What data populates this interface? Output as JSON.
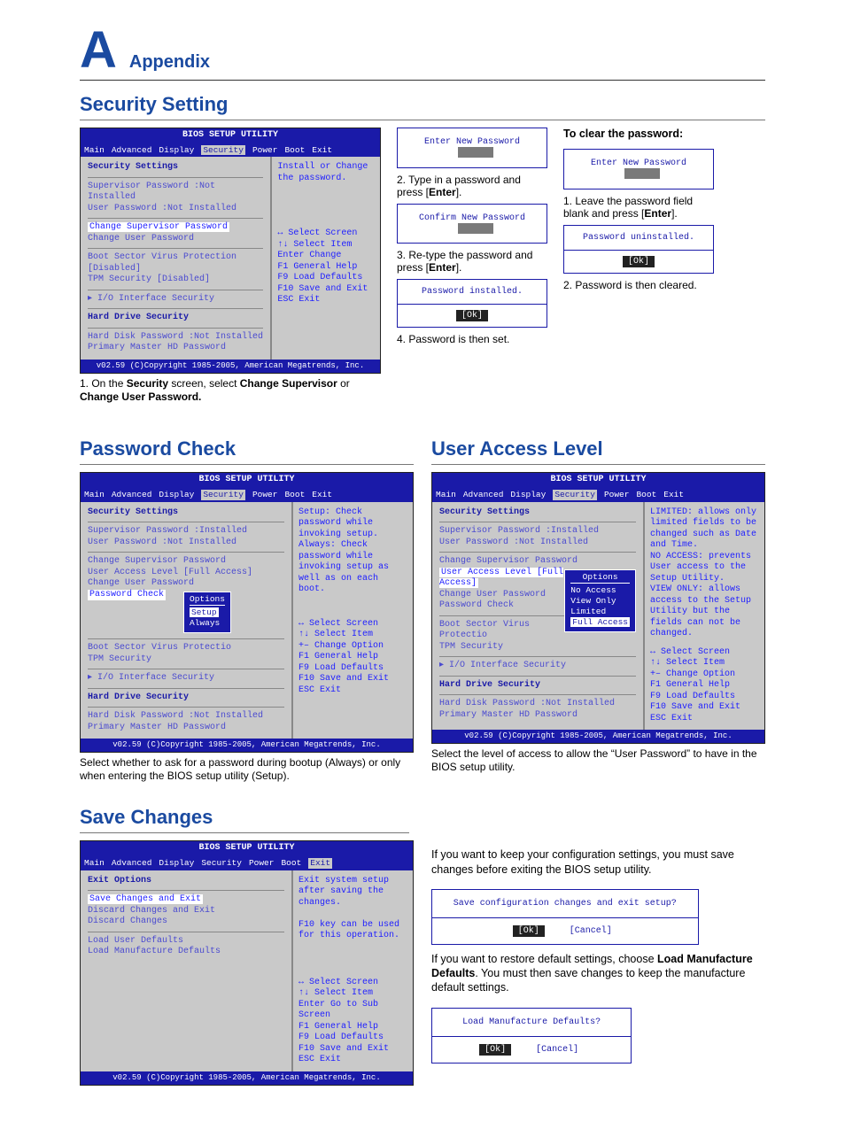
{
  "appendix": {
    "letter": "A",
    "label": "Appendix"
  },
  "sections": {
    "security": "Security Setting",
    "pwcheck": "Password Check",
    "ual": "User Access Level",
    "save": "Save Changes"
  },
  "bios_common": {
    "title": "BIOS SETUP UTILITY",
    "menus": [
      "Main",
      "Advanced",
      "Display",
      "Security",
      "Power",
      "Boot",
      "Exit"
    ],
    "footer": "v02.59 (C)Copyright 1985-2005, American Megatrends, Inc."
  },
  "bios1": {
    "active_menu": "Security",
    "pane_l_title": "Security Settings",
    "rows": [
      "Supervisor Password :Not Installed",
      "User Password       :Not Installed"
    ],
    "sel": "Change Supervisor Password",
    "rows2": [
      "Change User Password"
    ],
    "rows3": [
      "Boot Sector Virus Protection   [Disabled]",
      "TPM Security                   [Disabled]"
    ],
    "rows4": [
      "▸ I/O Interface Security"
    ],
    "hds_title": "Hard Drive Security",
    "rows5": [
      "Hard Disk Password  :Not Installed",
      "Primary Master HD Password"
    ],
    "help_top": "Install or Change the password.",
    "keys": [
      "↔     Select Screen",
      "↑↓    Select Item",
      "Enter Change",
      "F1    General Help",
      "F9    Load Defaults",
      "F10   Save and Exit",
      "ESC   Exit"
    ]
  },
  "bios1_caption": {
    "pre": "1. On the ",
    "b1": "Security",
    "mid": " screen, select ",
    "b2": "Change Supervisor",
    "mid2": " or ",
    "b3": "Change User Password."
  },
  "dlg_enter": "Enter New Password",
  "dlg_confirm": "Confirm New Password",
  "dlg_installed": "Password installed.",
  "dlg_uninstalled": "Password uninstalled.",
  "ok": "[Ok]",
  "cancel": "[Cancel]",
  "step2": {
    "pre": "2. Type in a password and press [",
    "b": "Enter",
    "post": "]."
  },
  "step3": {
    "pre": "3. Re-type the password and press [",
    "b": "Enter",
    "post": "]."
  },
  "step4": "4. Password is then set.",
  "clear_hdr": "To clear the password:",
  "clear1": {
    "pre": "1. Leave the password field blank and press [",
    "b": "Enter",
    "post": "]."
  },
  "clear2": "2. Password is then cleared.",
  "bios2": {
    "active_menu": "Security",
    "pane_l_title": "Security Settings",
    "rows": [
      "Supervisor Password :Installed",
      "User Password       :Not Installed"
    ],
    "rows2": [
      "Change Supervisor Password",
      "User Access Level          [Full Access]",
      "Change User Password"
    ],
    "sel": "Password Check",
    "popup_title": "Options",
    "popup_sel": "Setup",
    "popup_other": "Always",
    "rows3": [
      "Boot Sector Virus Protectio",
      "TPM Security"
    ],
    "rows4": [
      "▸ I/O Interface Security"
    ],
    "hds_title": "Hard Drive Security",
    "rows5": [
      "Hard Disk Password  :Not Installed",
      "Primary Master HD Password"
    ],
    "help_top": "Setup: Check password while invoking setup. Always: Check password while invoking setup as well as on each boot.",
    "keys": [
      "↔     Select Screen",
      "↑↓    Select Item",
      "+–    Change Option",
      "F1    General Help",
      "F9    Load Defaults",
      "F10   Save and Exit",
      "ESC   Exit"
    ]
  },
  "bios2_caption": "Select whether to ask for a password during bootup (Always) or only when entering the BIOS setup utility (Setup).",
  "bios3": {
    "active_menu": "Security",
    "pane_l_title": "Security Settings",
    "rows": [
      "Supervisor Password :Installed",
      "User Password       :Not Installed"
    ],
    "rows2a": "Change Supervisor Password",
    "sel": "User Access Level          [Full Access]",
    "rows2b": [
      "Change User Password",
      "Password Check"
    ],
    "popup_title": "Options",
    "popup_items": [
      "No Access",
      "View Only",
      "Limited"
    ],
    "popup_sel": "Full Access",
    "rows3": [
      "Boot Sector Virus Protectio",
      "TPM Security"
    ],
    "rows4": [
      "▸ I/O Interface Security"
    ],
    "hds_title": "Hard Drive Security",
    "rows5": [
      "Hard Disk Password  :Not Installed",
      "Primary Master HD Password"
    ],
    "help_top": "LIMITED: allows only limited fields to be changed such as Date and Time.\nNO ACCESS: prevents User access to the Setup Utility.\nVIEW ONLY: allows access to the Setup Utility but the fields can not be changed.",
    "keys": [
      "↔     Select Screen",
      "↑↓    Select Item",
      "+–    Change Option",
      "F1    General Help",
      "F9    Load Defaults",
      "F10   Save and Exit",
      "ESC   Exit"
    ]
  },
  "bios3_caption": "Select the level of access to allow the “User Password” to have in the BIOS setup utility.",
  "bios4": {
    "active_menu": "Exit",
    "pane_l_title": "Exit Options",
    "sel": "Save Changes and Exit",
    "rows": [
      "Discard Changes and Exit",
      "Discard Changes"
    ],
    "rows2": [
      "Load User Defaults",
      "Load Manufacture Defaults"
    ],
    "help_top": "Exit system setup after saving the changes.\n\nF10 key can be used for this operation.",
    "keys": [
      "↔     Select Screen",
      "↑↓    Select Item",
      "Enter Go to Sub Screen",
      "F1    General Help",
      "F9    Load Defaults",
      "F10   Save and Exit",
      "ESC   Exit"
    ]
  },
  "save_para1": "If you want to keep your configuration settings, you must save changes before exiting the BIOS setup utility.",
  "save_confirm_q": "Save configuration changes and exit setup?",
  "save_para2": {
    "pre": "If you want to restore default settings, choose ",
    "b": "Load Manufacture Defaults",
    "post": ". You must then save changes to keep the manufacture default settings."
  },
  "load_defaults_q": "Load Manufacture Defaults?"
}
